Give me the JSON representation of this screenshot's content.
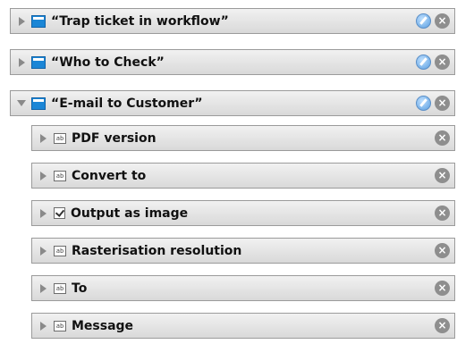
{
  "workflows": [
    {
      "label": "“Trap ticket in workflow”",
      "expanded": false,
      "icon": "event-icon"
    },
    {
      "label": "“Who to Check”",
      "expanded": false,
      "icon": "event-icon"
    },
    {
      "label": "“E-mail to Customer”",
      "expanded": true,
      "icon": "event-icon"
    }
  ],
  "fields": [
    {
      "label": "PDF version",
      "icon": "text-field-icon"
    },
    {
      "label": "Convert to",
      "icon": "text-field-icon"
    },
    {
      "label": "Output as image",
      "icon": "checkbox-icon"
    },
    {
      "label": "Rasterisation resolution",
      "icon": "text-field-icon"
    },
    {
      "label": "To",
      "icon": "text-field-icon"
    },
    {
      "label": "Message",
      "icon": "text-field-icon"
    }
  ],
  "icons": {
    "text_field_glyph": "ab",
    "close_glyph": "×"
  }
}
